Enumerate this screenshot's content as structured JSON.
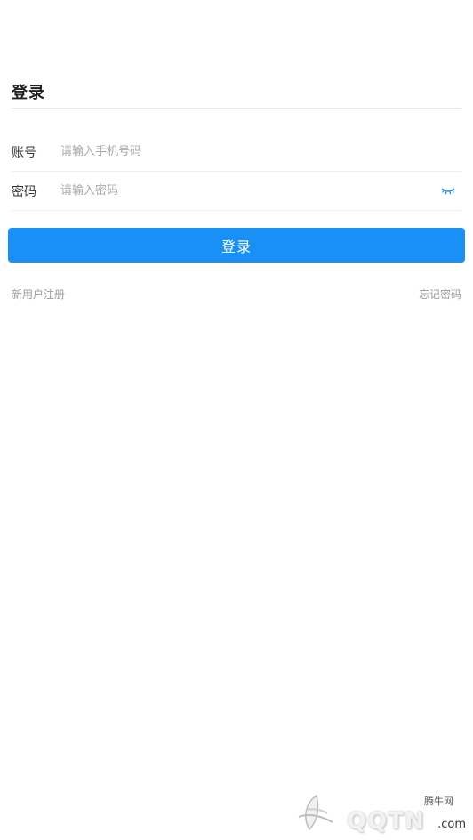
{
  "header": {
    "title": "登录"
  },
  "form": {
    "account": {
      "label": "账号",
      "placeholder": "请输入手机号码",
      "value": ""
    },
    "password": {
      "label": "密码",
      "placeholder": "请输入密码",
      "value": "",
      "toggle_icon": "eye-closed-icon"
    }
  },
  "actions": {
    "login_label": "登录",
    "register_label": "新用户注册",
    "forgot_label": "忘记密码"
  },
  "watermark": {
    "site_name": "腾牛网",
    "brand": "QQTN",
    "domain": ".com"
  },
  "colors": {
    "primary": "#1890f5",
    "eye_icon": "#1890f5",
    "link": "#999999"
  }
}
